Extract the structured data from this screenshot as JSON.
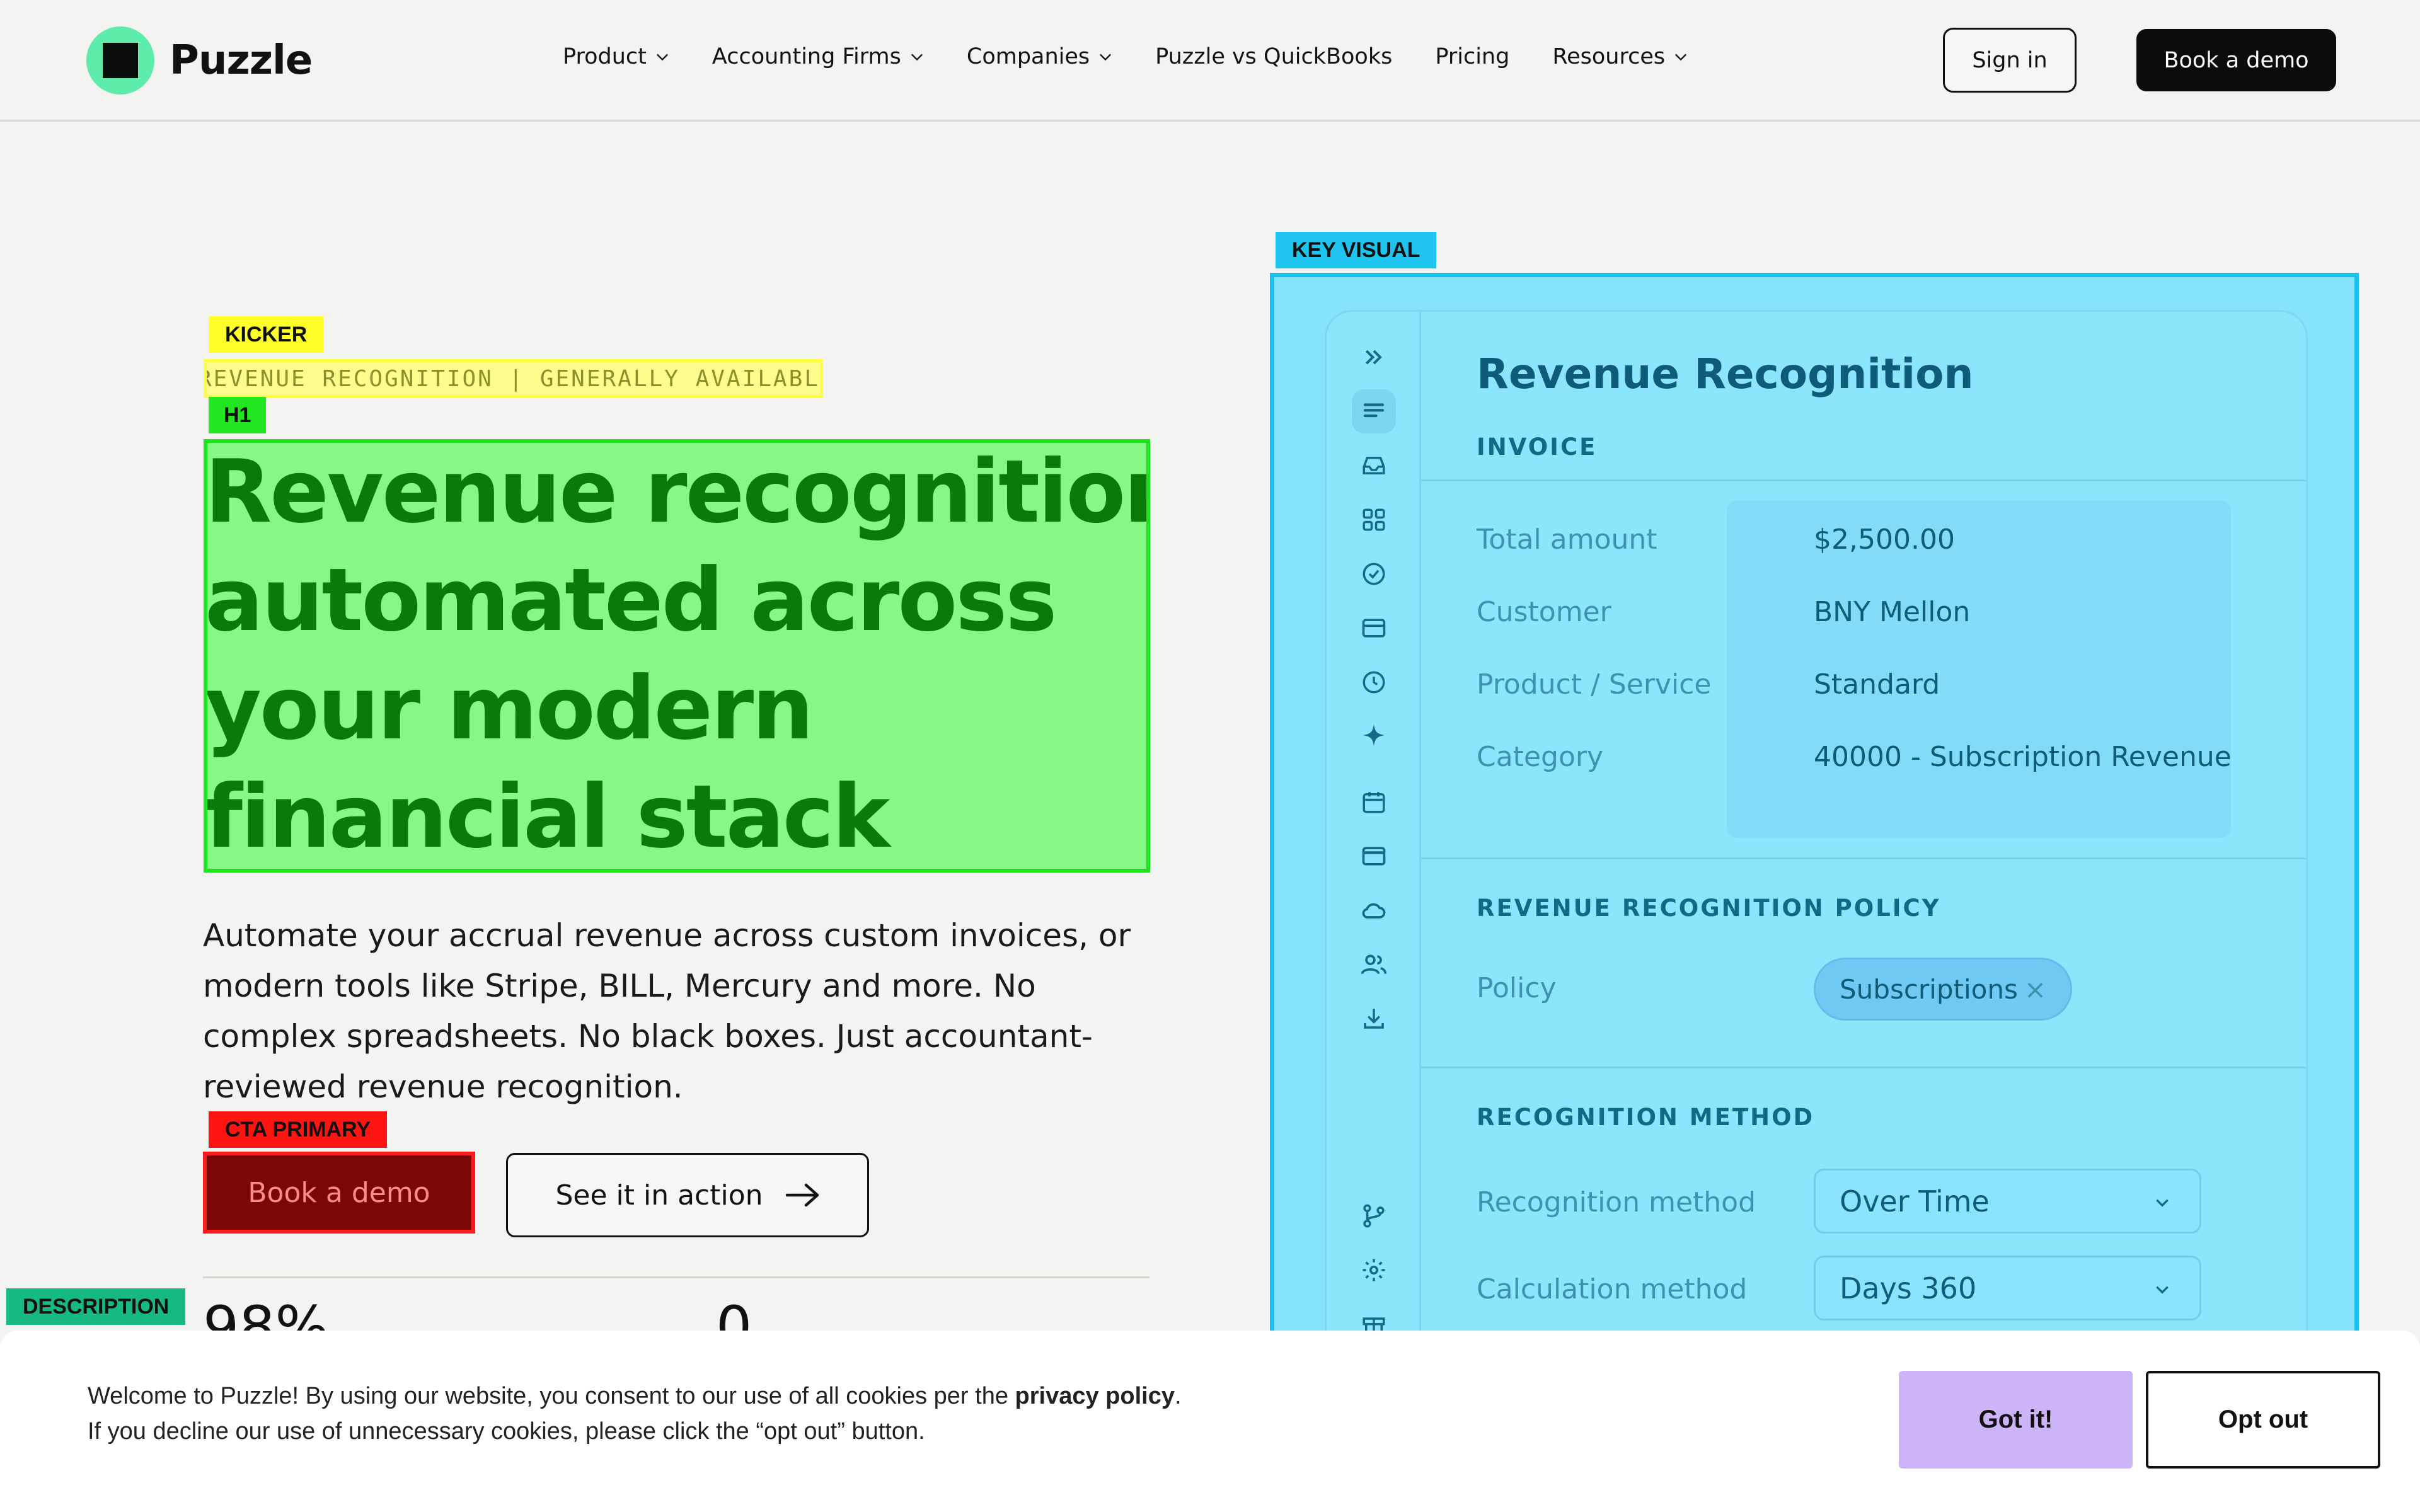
{
  "brand": {
    "name": "Puzzle",
    "logo_icon": "puzzle-logo-icon",
    "accent": "#5eecab"
  },
  "nav": {
    "items": [
      {
        "label": "Product",
        "has_dropdown": true
      },
      {
        "label": "Accounting Firms",
        "has_dropdown": true
      },
      {
        "label": "Companies",
        "has_dropdown": true
      },
      {
        "label": "Puzzle vs QuickBooks",
        "has_dropdown": false
      },
      {
        "label": "Pricing",
        "has_dropdown": false
      },
      {
        "label": "Resources",
        "has_dropdown": true
      }
    ],
    "sign_in": "Sign in",
    "book_demo": "Book a demo"
  },
  "annotations": {
    "kicker": "KICKER",
    "h1": "H1",
    "cta_primary": "CTA PRIMARY",
    "description": "DESCRIPTION",
    "key_visual": "KEY VISUAL",
    "colors": {
      "kicker": "#ffff2a",
      "h1": "#22e622",
      "cta": "#ff1414",
      "description": "#16b884",
      "key_visual": "#1ec4ee"
    }
  },
  "hero": {
    "kicker": "REVENUE RECOGNITION | GENERALLY AVAILABLE",
    "headline_lines": [
      "Revenue recognition,",
      "automated across",
      "your modern",
      "financial stack"
    ],
    "description": "Automate your accrual revenue across custom invoices, or modern tools like Stripe, BILL, Mercury and more. No complex spreadsheets. No black boxes. Just accountant-reviewed revenue recognition.",
    "cta_primary": "Book a demo",
    "cta_secondary": "See it in action",
    "stats": [
      "98%",
      "0"
    ]
  },
  "key_visual": {
    "title": "Revenue Recognition",
    "sidebar_icons": [
      "chevrons-right-icon",
      "list-icon",
      "inbox-icon",
      "grid-icon",
      "check-circle-icon",
      "card-icon",
      "clock-icon",
      "sparkle-icon",
      "calendar-icon",
      "wallet-icon",
      "cloud-icon",
      "users-icon",
      "download-icon",
      "branch-icon",
      "gear-icon",
      "gift-icon"
    ],
    "invoice": {
      "heading": "INVOICE",
      "rows": [
        {
          "label": "Total amount",
          "value": "$2,500.00"
        },
        {
          "label": "Customer",
          "value": "BNY Mellon"
        },
        {
          "label": "Product / Service",
          "value": "Standard"
        },
        {
          "label": "Category",
          "value": "40000 - Subscription Revenue"
        }
      ]
    },
    "policy": {
      "heading": "REVENUE RECOGNITION POLICY",
      "label": "Policy",
      "chip": "Subscriptions",
      "chip_remove": "×"
    },
    "method": {
      "heading": "RECOGNITION METHOD",
      "rows": [
        {
          "label": "Recognition method",
          "value": "Over Time"
        },
        {
          "label": "Calculation method",
          "value": "Days 360"
        }
      ]
    }
  },
  "cookie": {
    "line1_before": "Welcome to Puzzle! By using our website, you consent to our use of all cookies per the ",
    "line1_link": "privacy policy",
    "line1_after": ".",
    "line2": "If you decline our use of unnecessary cookies, please click the “opt out” button.",
    "accept": "Got it!",
    "decline": "Opt out"
  }
}
